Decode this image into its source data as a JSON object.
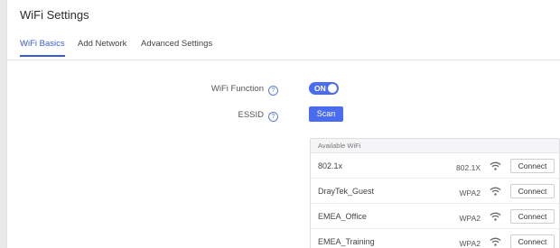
{
  "page": {
    "title": "WiFi Settings"
  },
  "tabs": [
    {
      "label": "WiFi Basics",
      "active": true
    },
    {
      "label": "Add Network",
      "active": false
    },
    {
      "label": "Advanced Settings",
      "active": false
    }
  ],
  "form": {
    "wifi_function_label": "WiFi Function",
    "wifi_function_state": "ON",
    "essid_label": "ESSID",
    "scan_label": "Scan",
    "help_glyph": "?"
  },
  "available_wifi": {
    "header": "Available WiFi",
    "networks": [
      {
        "ssid": "802.1x",
        "security": "802.1X",
        "connect_label": "Connect"
      },
      {
        "ssid": "DrayTek_Guest",
        "security": "WPA2",
        "connect_label": "Connect"
      },
      {
        "ssid": "EMEA_Office",
        "security": "WPA2",
        "connect_label": "Connect"
      },
      {
        "ssid": "EMEA_Training",
        "security": "WPA2",
        "connect_label": "Connect"
      }
    ]
  },
  "colors": {
    "accent": "#4a6cf0",
    "active_tab": "#3a5bd9"
  },
  "icons": {
    "help": "help-circle-icon",
    "signal": "wifi-signal-icon"
  }
}
